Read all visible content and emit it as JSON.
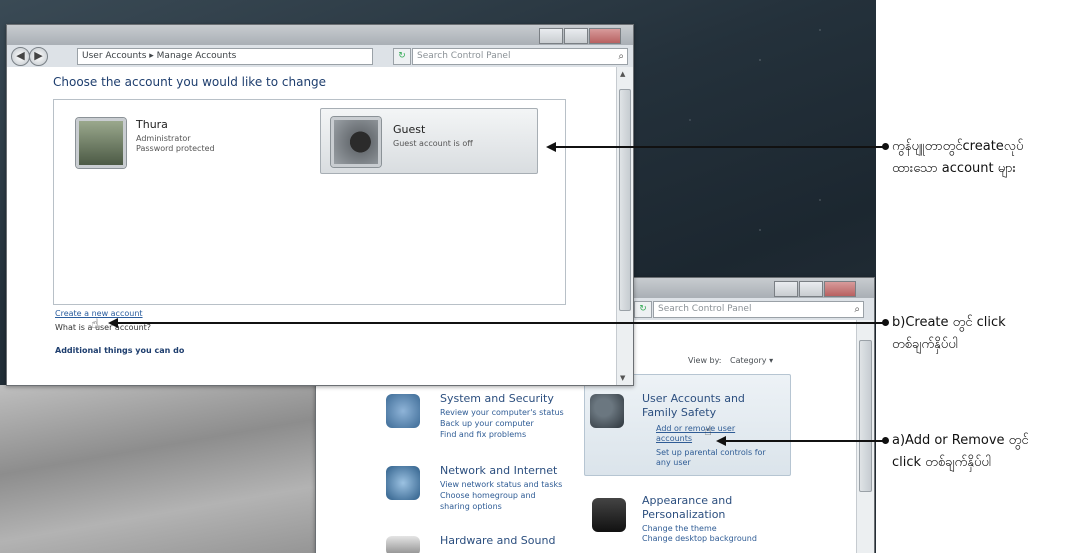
{
  "manage_accounts": {
    "breadcrumb": [
      "User Accounts",
      "Manage Accounts"
    ],
    "search_placeholder": "Search Control Panel",
    "heading": "Choose the account you would like to change",
    "accounts": [
      {
        "name": "Thura",
        "lines": [
          "Administrator",
          "Password protected"
        ]
      },
      {
        "name": "Guest",
        "lines": [
          "Guest account is off"
        ]
      }
    ],
    "create_link": "Create a new account",
    "what_is": "What is a user account?",
    "additional": "Additional things you can do"
  },
  "control_panel": {
    "search_placeholder": "Search Control Panel",
    "view_by_label": "View by:",
    "view_by_value": "Category ▾",
    "categories": [
      {
        "title": "System and Security",
        "links": [
          "Review your computer's status",
          "Back up your computer",
          "Find and fix problems"
        ]
      },
      {
        "title": "Network and Internet",
        "links": [
          "View network status and tasks",
          "Choose homegroup and",
          "sharing options"
        ]
      },
      {
        "title": "Hardware and Sound",
        "links": []
      },
      {
        "title_lines": [
          "User Accounts and",
          "Family Safety"
        ],
        "links": [
          "Add or remove user",
          "accounts",
          "Set up parental controls for",
          "any user"
        ]
      },
      {
        "title_lines": [
          "Appearance and",
          "Personalization"
        ],
        "links": [
          "Change the theme",
          "Change desktop background"
        ]
      }
    ]
  },
  "annotations": [
    {
      "lines": [
        "ကွန်ပျူတာတွင်createလုပ်",
        "ထားသော account များ"
      ]
    },
    {
      "lines": [
        "b)Create တွင် click",
        "တစ်ချက်နှိပ်ပါ"
      ]
    },
    {
      "lines": [
        "a)Add or Remove တွင်",
        "click တစ်ချက်နှိပ်ပါ"
      ]
    }
  ],
  "icons": [
    "back-arrow-icon",
    "forward-arrow-icon",
    "magnifier-icon",
    "refresh-icon",
    "hand-cursor-icon"
  ]
}
